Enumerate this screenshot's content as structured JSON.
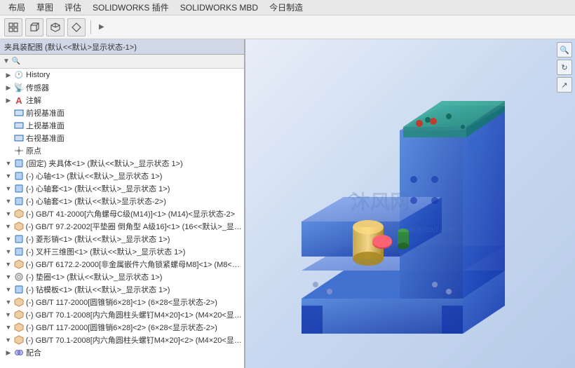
{
  "menubar": {
    "items": [
      "布局",
      "草图",
      "评估",
      "SOLIDWORKS 插件",
      "SOLIDWORKS MBD",
      "今日制造"
    ]
  },
  "toolbar": {
    "buttons": [
      "grid",
      "box",
      "cube",
      "diamond"
    ]
  },
  "panel": {
    "header": "夹具装配图 (默认<<默认>显示状态-1>)",
    "tree": [
      {
        "id": "history",
        "indent": 1,
        "expand": false,
        "icon": "clock",
        "label": "History",
        "type": "history"
      },
      {
        "id": "sensor",
        "indent": 1,
        "expand": false,
        "icon": "sensor",
        "label": "传感器",
        "type": "sensor"
      },
      {
        "id": "annotation",
        "indent": 1,
        "expand": false,
        "icon": "A",
        "label": "注解",
        "type": "annotation"
      },
      {
        "id": "front",
        "indent": 1,
        "expand": false,
        "icon": "plane",
        "label": "前视基准面",
        "type": "plane"
      },
      {
        "id": "top",
        "indent": 1,
        "expand": false,
        "icon": "plane",
        "label": "上视基准面",
        "type": "plane"
      },
      {
        "id": "right",
        "indent": 1,
        "expand": false,
        "icon": "plane",
        "label": "右视基准面",
        "type": "plane"
      },
      {
        "id": "origin",
        "indent": 1,
        "expand": false,
        "icon": "origin",
        "label": "原点",
        "type": "origin"
      },
      {
        "id": "comp1",
        "indent": 1,
        "expand": true,
        "icon": "comp",
        "label": "(固定) 夹具体<1> (默认<<默认>_显示状态 1>)",
        "type": "component"
      },
      {
        "id": "comp2",
        "indent": 1,
        "expand": true,
        "icon": "comp",
        "label": "(-) 心轴<1> (默认<<默认>_显示状态 1>)",
        "type": "component",
        "suppressed": false
      },
      {
        "id": "comp3",
        "indent": 1,
        "expand": true,
        "icon": "comp",
        "label": "(-) 心轴套<1> (默认<<默认>_显示状态 1>)",
        "type": "component"
      },
      {
        "id": "comp4",
        "indent": 1,
        "expand": true,
        "icon": "comp",
        "label": "(-) 心轴套<1> (默认<<默认>显示状态-2>)",
        "type": "component"
      },
      {
        "id": "comp5",
        "indent": 1,
        "expand": true,
        "icon": "fastener",
        "label": "(-) GB/T 41-2000[六角螺母C级(M14)]<1> (M14)<显示状态-2>",
        "type": "fastener"
      },
      {
        "id": "comp6",
        "indent": 1,
        "expand": true,
        "icon": "fastener",
        "label": "(-) GB/T 97.2-2002[平垫圈 倒角型 A级16]<1> (16<<默认>_显示状态...",
        "type": "fastener"
      },
      {
        "id": "comp7",
        "indent": 1,
        "expand": true,
        "icon": "comp",
        "label": "(-) 菱形销<1> (默认<<默认>_显示状态 1>)",
        "type": "component"
      },
      {
        "id": "comp8",
        "indent": 1,
        "expand": true,
        "icon": "comp",
        "label": "(-) 叉杆三维图<1> (默认<<默认>_显示状态 1>)",
        "type": "component"
      },
      {
        "id": "comp9",
        "indent": 1,
        "expand": true,
        "icon": "fastener",
        "label": "(-) GB/T 6172.2-2000[非金属嵌件六角锁紧螺母M8]<1> (M8<显示状...",
        "type": "fastener"
      },
      {
        "id": "comp10",
        "indent": 1,
        "expand": true,
        "icon": "ring",
        "label": "(-) 垫圈<1> (默认<<默认>_显示状态 1>)",
        "type": "ring"
      },
      {
        "id": "comp11",
        "indent": 1,
        "expand": true,
        "icon": "comp",
        "label": "(-) 钻模板<1> (默认<<默认>_显示状态 1>)",
        "type": "component"
      },
      {
        "id": "comp12",
        "indent": 1,
        "expand": true,
        "icon": "fastener",
        "label": "(-) GB/T 117-2000[圆锥销6×28]<1> (6×28<显示状态-2>)",
        "type": "fastener"
      },
      {
        "id": "comp13",
        "indent": 1,
        "expand": true,
        "icon": "fastener",
        "label": "(-) GB/T 70.1-2008[内六角圆柱头螺钉M4×20]<1> (M4×20<显示状态-...",
        "type": "fastener"
      },
      {
        "id": "comp14",
        "indent": 1,
        "expand": true,
        "icon": "fastener",
        "label": "(-) GB/T 117-2000[圆锥销6×28]<2> (6×28<显示状态-2>)",
        "type": "fastener"
      },
      {
        "id": "comp15",
        "indent": 1,
        "expand": true,
        "icon": "fastener",
        "label": "(-) GB/T 70.1-2008[内六角圆柱头螺钉M4×20]<2> (M4×20<显示状态-...",
        "type": "fastener"
      },
      {
        "id": "mate",
        "indent": 1,
        "expand": false,
        "icon": "mate",
        "label": "配合",
        "type": "mate"
      }
    ]
  },
  "viewport": {
    "watermark": "沐风网",
    "watermark_url": "www.mfcad.com",
    "right_icons": [
      "🔍",
      "🔄",
      "↗"
    ]
  }
}
